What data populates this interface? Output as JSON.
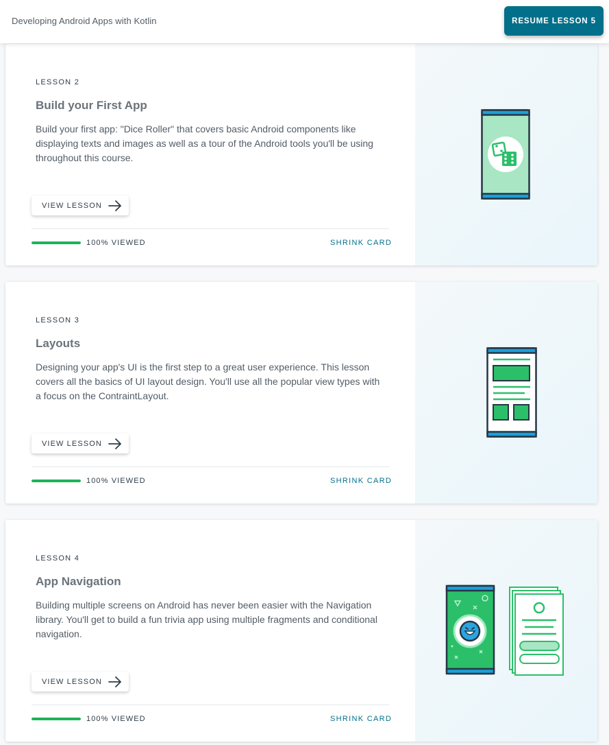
{
  "header": {
    "course_title": "Developing Android Apps with Kotlin",
    "resume_label": "RESUME LESSON 5"
  },
  "lessons": [
    {
      "number": "LESSON 2",
      "title": "Build your First App",
      "description": "Build your first app: \"Dice Roller\" that covers basic Android components like displaying texts and images as well as a tour of the Android tools you'll be using throughout this course.",
      "view_label": "VIEW LESSON",
      "progress_text": "100% VIEWED",
      "progress": 1.0,
      "shrink_label": "SHRINK CARD",
      "illustration": "phone-dice-icon"
    },
    {
      "number": "LESSON 3",
      "title": "Layouts",
      "description": "Designing your app's UI is the first step to a great user experience. This lesson covers all the basics of UI layout design. You'll use all the popular view types with a focus on the ContraintLayout.",
      "view_label": "VIEW LESSON",
      "progress_text": "100% VIEWED",
      "progress": 1.0,
      "shrink_label": "SHRINK CARD",
      "illustration": "phone-layout-icon"
    },
    {
      "number": "LESSON 4",
      "title": "App Navigation",
      "description": "Building multiple screens on Android has never been easier with the Navigation library. You'll get to build a fun trivia app using multiple fragments and conditional navigation.",
      "view_label": "VIEW LESSON",
      "progress_text": "100% VIEWED",
      "progress": 1.0,
      "shrink_label": "SHRINK CARD",
      "illustration": "phone-navigation-icon"
    }
  ],
  "colors": {
    "accent": "#02708a",
    "progress": "#1fb25a",
    "phone_frame": "#1aa0d8",
    "phone_green": "#2bbf6a"
  }
}
